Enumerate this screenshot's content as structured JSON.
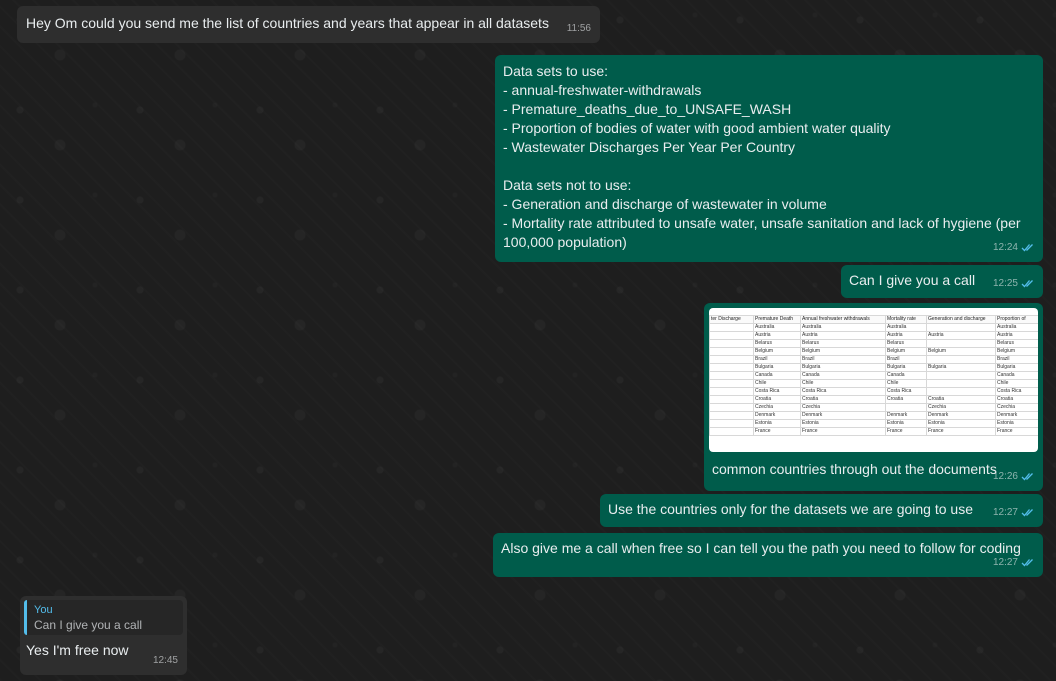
{
  "messages": [
    {
      "direction": "in",
      "text": "Hey Om could you send me the list of countries and years that appear in all datasets",
      "time": "11:56"
    },
    {
      "direction": "out",
      "text": "Data sets to use:\n- annual-freshwater-withdrawals\n- Premature_deaths_due_to_UNSAFE_WASH\n- Proportion of bodies of water with good ambient water quality\n- Wastewater Discharges Per Year Per Country\n\nData sets not to use:\n- Generation and discharge of wastewater in volume\n- Mortality rate attributed to unsafe water, unsafe sanitation and lack of hygiene (per\n100,000 population)",
      "time": "12:24"
    },
    {
      "direction": "out",
      "text": "Can I give you a call",
      "time": "12:25"
    },
    {
      "direction": "out",
      "caption": "common countries through out the documents",
      "time": "12:26",
      "image_table": {
        "headers": [
          "ter Discharge",
          "Premature Death",
          "Annual freshwater withdrawals",
          "Mortality rate",
          "Generation and discharge",
          "Proportion of"
        ],
        "rows": [
          [
            "",
            "Australia",
            "Australia",
            "Australia",
            "",
            "Australia"
          ],
          [
            "",
            "Austria",
            "Austria",
            "Austria",
            "Austria",
            "Austria"
          ],
          [
            "",
            "Belarus",
            "Belarus",
            "Belarus",
            "",
            "Belarus"
          ],
          [
            "",
            "Belgium",
            "Belgium",
            "Belgium",
            "Belgium",
            "Belgium"
          ],
          [
            "",
            "Brazil",
            "Brazil",
            "Brazil",
            "",
            "Brazil"
          ],
          [
            "",
            "Bulgaria",
            "Bulgaria",
            "Bulgaria",
            "Bulgaria",
            "Bulgaria"
          ],
          [
            "",
            "Canada",
            "Canada",
            "Canada",
            "",
            "Canada"
          ],
          [
            "",
            "Chile",
            "Chile",
            "Chile",
            "",
            "Chile"
          ],
          [
            "",
            "Costa Rica",
            "Costa Rica",
            "Costa Rica",
            "",
            "Costa Rica"
          ],
          [
            "",
            "Croatia",
            "Croatia",
            "Croatia",
            "Croatia",
            "Croatia"
          ],
          [
            "",
            "Czechia",
            "Czechia",
            "",
            "Czechia",
            "Czechia"
          ],
          [
            "",
            "Denmark",
            "Denmark",
            "Denmark",
            "Denmark",
            "Denmark"
          ],
          [
            "",
            "Estonia",
            "Estonia",
            "Estonia",
            "Estonia",
            "Estonia"
          ],
          [
            "",
            "France",
            "France",
            "France",
            "France",
            "France"
          ]
        ]
      }
    },
    {
      "direction": "out",
      "text": "Use the countries only for the datasets we are going to use",
      "time": "12:27"
    },
    {
      "direction": "out",
      "text": "Also give me a call when free so I can tell you the path you need to follow for coding",
      "time": "12:27"
    },
    {
      "direction": "in",
      "reply": {
        "author": "You",
        "text": "Can I give you a call"
      },
      "text": "Yes I'm free now",
      "time": "12:45"
    }
  ],
  "colors": {
    "incoming_bubble": "#2e2e2e",
    "outgoing_bubble": "#005c4b",
    "read_tick": "#53bdeb",
    "reply_accent": "#53bdeb"
  },
  "icons": {
    "read_receipt": "double-check-icon"
  }
}
